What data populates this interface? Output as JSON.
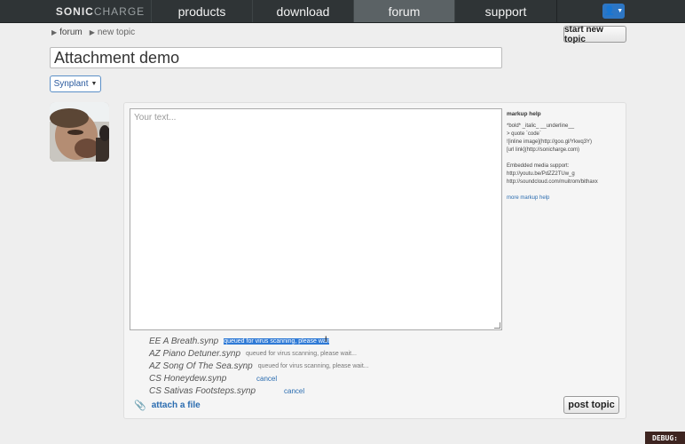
{
  "nav": {
    "logo_a": "SONIC",
    "logo_b": "CHARGE",
    "items": [
      {
        "label": "products"
      },
      {
        "label": "download"
      },
      {
        "label": "forum"
      },
      {
        "label": "support"
      }
    ],
    "active": "forum"
  },
  "breadcrumb": {
    "forum": "forum",
    "current": "new topic"
  },
  "buttons": {
    "start_new_topic": "start new topic",
    "post_topic": "post topic"
  },
  "topic": {
    "title": "Attachment demo",
    "category": "Synplant"
  },
  "editor": {
    "placeholder": "Your text..."
  },
  "markup_help": {
    "title": "markup help",
    "lines": [
      "*bold*   _italic_   __underline__",
      "> quote    `code`",
      "![inline image](http://goo.gl/Ykwq3Y)",
      "[url link](http://sonicharge.com)"
    ],
    "embed_title": "Embedded media support:",
    "embed_lines": [
      "http://youtu.be/PdZZ2TUw_g",
      "http://soundcloud.com/muitrom/bithaxx"
    ],
    "more": "more markup help"
  },
  "attachments": [
    {
      "name": "EE A Breath.synp",
      "status": "queued for virus scanning, please wait",
      "selected": true
    },
    {
      "name": "AZ Piano Detuner.synp",
      "status": "queued for virus scanning, please wait..."
    },
    {
      "name": "AZ Song Of The Sea.synp",
      "status": "queued for virus scanning, please wait..."
    },
    {
      "name": "CS Honeydew.synp",
      "cancel": "cancel"
    },
    {
      "name": "CS Sativas Footsteps.synp",
      "cancel": "cancel"
    }
  ],
  "attach_label": "attach a file",
  "debug": "DEBUG:"
}
